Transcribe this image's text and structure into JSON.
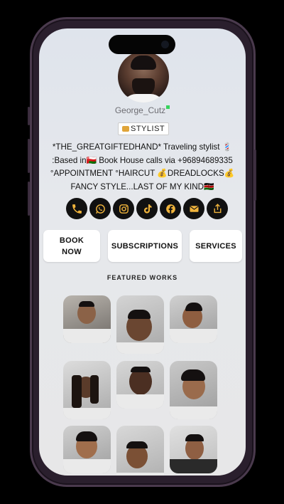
{
  "profile": {
    "username": "George_Cutz",
    "role": "STYLIST",
    "bio_lines": [
      "*THE_GREATGIFTEDHAND* Traveling stylist 💈",
      ":Based in🇴🇲 Book House calls via +96894689335",
      "°APPOINTMENT °HAIRCUT 💰DREADLOCKS💰",
      "FANCY STYLE...LAST OF MY KIND🇰🇪"
    ]
  },
  "socials": [
    {
      "name": "phone-icon"
    },
    {
      "name": "whatsapp-icon"
    },
    {
      "name": "instagram-icon"
    },
    {
      "name": "tiktok-icon"
    },
    {
      "name": "facebook-icon"
    },
    {
      "name": "email-icon"
    },
    {
      "name": "share-icon"
    }
  ],
  "actions": {
    "book": "BOOK NOW",
    "subscriptions": "SUBSCRIPTIONS",
    "services": "SERVICES"
  },
  "featured": {
    "title": "FEATURED WORKS",
    "count": 9
  },
  "colors": {
    "social_bg": "#111111",
    "social_icon": "#f0b43c",
    "online": "#37d35d"
  }
}
